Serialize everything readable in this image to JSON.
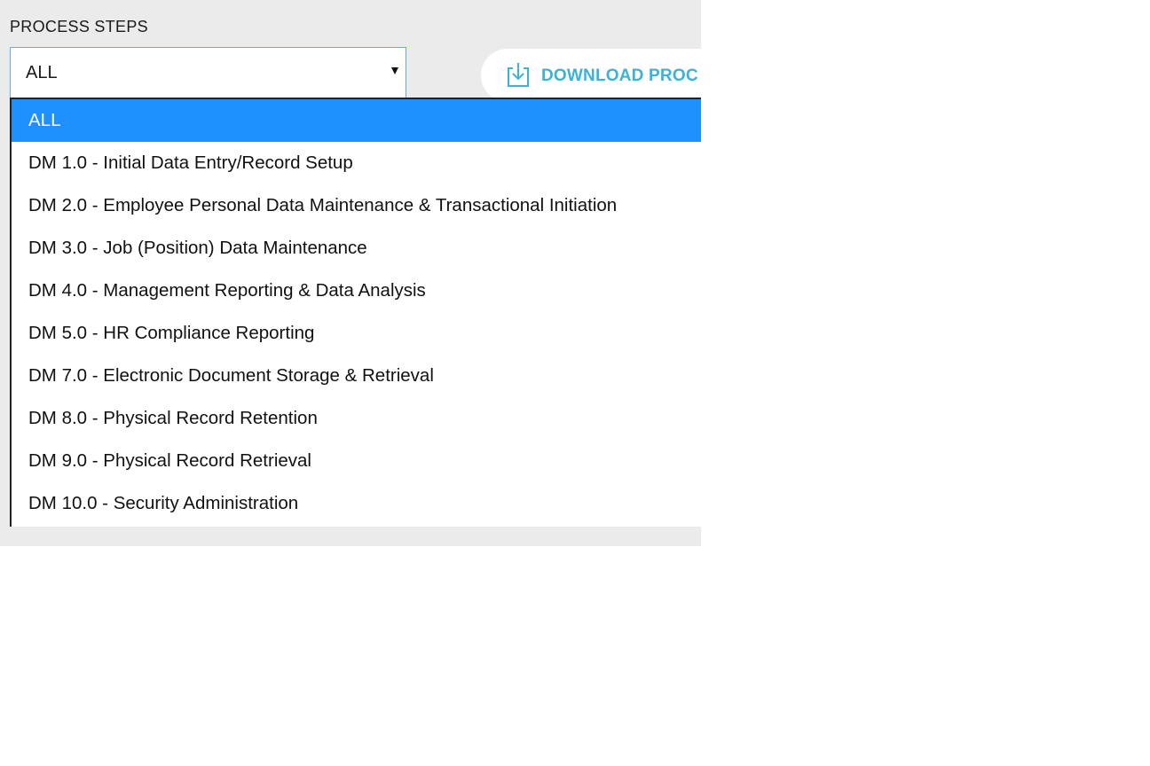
{
  "process_steps": {
    "label": "PROCESS STEPS",
    "selected_value": "ALL",
    "options": [
      "ALL",
      "DM 1.0 - Initial Data Entry/Record Setup",
      "DM 2.0 - Employee Personal Data Maintenance & Transactional Initiation",
      "DM 3.0 - Job (Position) Data Maintenance",
      "DM 4.0 - Management Reporting & Data Analysis",
      "DM 5.0 - HR Compliance Reporting",
      "DM 7.0 - Electronic Document Storage & Retrieval",
      "DM 8.0 - Physical Record Retention",
      "DM 9.0 - Physical Record Retrieval",
      "DM 10.0 - Security Administration"
    ],
    "highlighted_index": 0
  },
  "download_button": {
    "label": "DOWNLOAD PROC",
    "icon": "download-icon"
  },
  "colors": {
    "accent": "#3ab3d6",
    "selection": "#1e90ff",
    "background": "#ebebeb"
  }
}
